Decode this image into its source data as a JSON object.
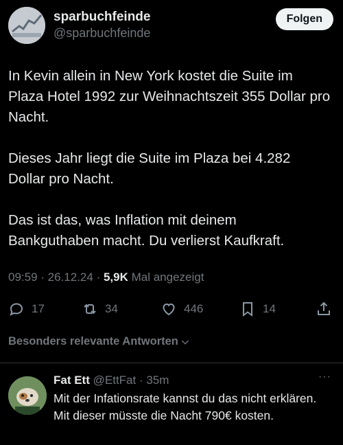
{
  "author": {
    "name": "sparbuchfeinde",
    "handle": "@sparbuchfeinde",
    "follow_label": "Folgen"
  },
  "tweet": {
    "paragraphs": [
      "In Kevin allein in New York kostet die Suite im Plaza Hotel 1992 zur Weihnachtszeit 355 Dollar pro Nacht.",
      "Dieses Jahr liegt die Suite im Plaza bei 4.282 Dollar pro Nacht.",
      "Das ist das, was Inflation mit deinem Bankguthaben macht. Du verlierst Kaufkraft."
    ],
    "time": "09:59",
    "sep1": " · ",
    "date": "26.12.24",
    "sep2": " · ",
    "views": "5,9K",
    "views_suffix": " Mal angezeigt"
  },
  "actions": {
    "replies": "17",
    "reposts": "34",
    "likes": "446",
    "bookmarks": "14"
  },
  "replies_filter": "Besonders relevante Antworten",
  "reply": {
    "name": "Fat Ett",
    "handle": "@EttFat",
    "time": " · 35m",
    "more": "···",
    "text": "Mit der Infationsrate kannst du das nicht erklären. Mit dieser müsste die Nacht 790€ kosten."
  },
  "icons": {
    "reply": "speech-bubble-icon",
    "repost": "repost-icon",
    "like": "heart-icon",
    "bookmark": "bookmark-icon",
    "share": "share-icon",
    "chevron": "chevron-down-icon"
  },
  "colors": {
    "background": "#000000",
    "text": "#e7e9ea",
    "secondary": "#71767b",
    "follow_bg": "#eff3f4"
  }
}
